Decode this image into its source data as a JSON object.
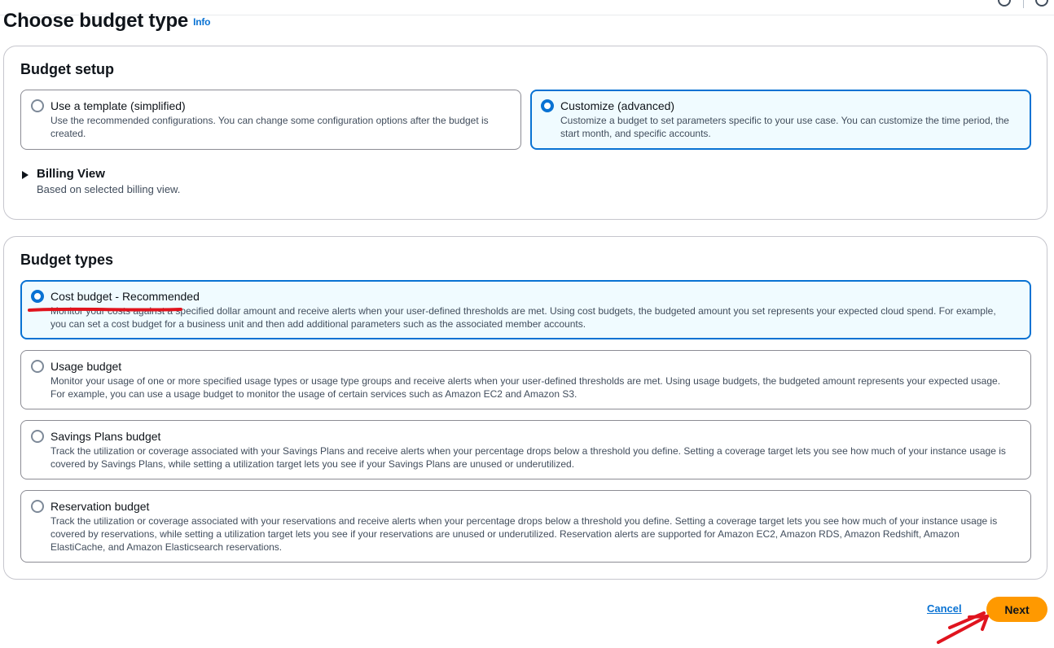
{
  "page": {
    "title": "Choose budget type",
    "info_link": "Info"
  },
  "budget_setup": {
    "heading": "Budget setup",
    "options": [
      {
        "title": "Use a template (simplified)",
        "description": "Use the recommended configurations. You can change some configuration options after the budget is created.",
        "selected": false
      },
      {
        "title": "Customize (advanced)",
        "description": "Customize a budget to set parameters specific to your use case. You can customize the time period, the start month, and specific accounts.",
        "selected": true
      }
    ],
    "billing_view": {
      "title": "Billing View",
      "description": "Based on selected billing view."
    }
  },
  "budget_types": {
    "heading": "Budget types",
    "options": [
      {
        "title": "Cost budget - Recommended",
        "description": "Monitor your costs against a specified dollar amount and receive alerts when your user-defined thresholds are met. Using cost budgets, the budgeted amount you set represents your expected cloud spend. For example, you can set a cost budget for a business unit and then add additional parameters such as the associated member accounts.",
        "selected": true
      },
      {
        "title": "Usage budget",
        "description": "Monitor your usage of one or more specified usage types or usage type groups and receive alerts when your user-defined thresholds are met. Using usage budgets, the budgeted amount represents your expected usage. For example, you can use a usage budget to monitor the usage of certain services such as Amazon EC2 and Amazon S3.",
        "selected": false
      },
      {
        "title": "Savings Plans budget",
        "description": "Track the utilization or coverage associated with your Savings Plans and receive alerts when your percentage drops below a threshold you define. Setting a coverage target lets you see how much of your instance usage is covered by Savings Plans, while setting a utilization target lets you see if your Savings Plans are unused or underutilized.",
        "selected": false
      },
      {
        "title": "Reservation budget",
        "description": "Track the utilization or coverage associated with your reservations and receive alerts when your percentage drops below a threshold you define. Setting a coverage target lets you see how much of your instance usage is covered by reservations, while setting a utilization target lets you see if your reservations are unused or underutilized. Reservation alerts are supported for Amazon EC2, Amazon RDS, Amazon Redshift, Amazon ElastiCache, and Amazon Elasticsearch reservations.",
        "selected": false
      }
    ]
  },
  "actions": {
    "cancel_label": "Cancel",
    "next_label": "Next"
  },
  "colors": {
    "accent": "#0972d3",
    "primary_button": "#ff9900",
    "annotation": "#e0141e"
  },
  "icons": [
    "info-icon",
    "settings-icon",
    "caret-right-icon",
    "annotation-arrow-icon"
  ]
}
